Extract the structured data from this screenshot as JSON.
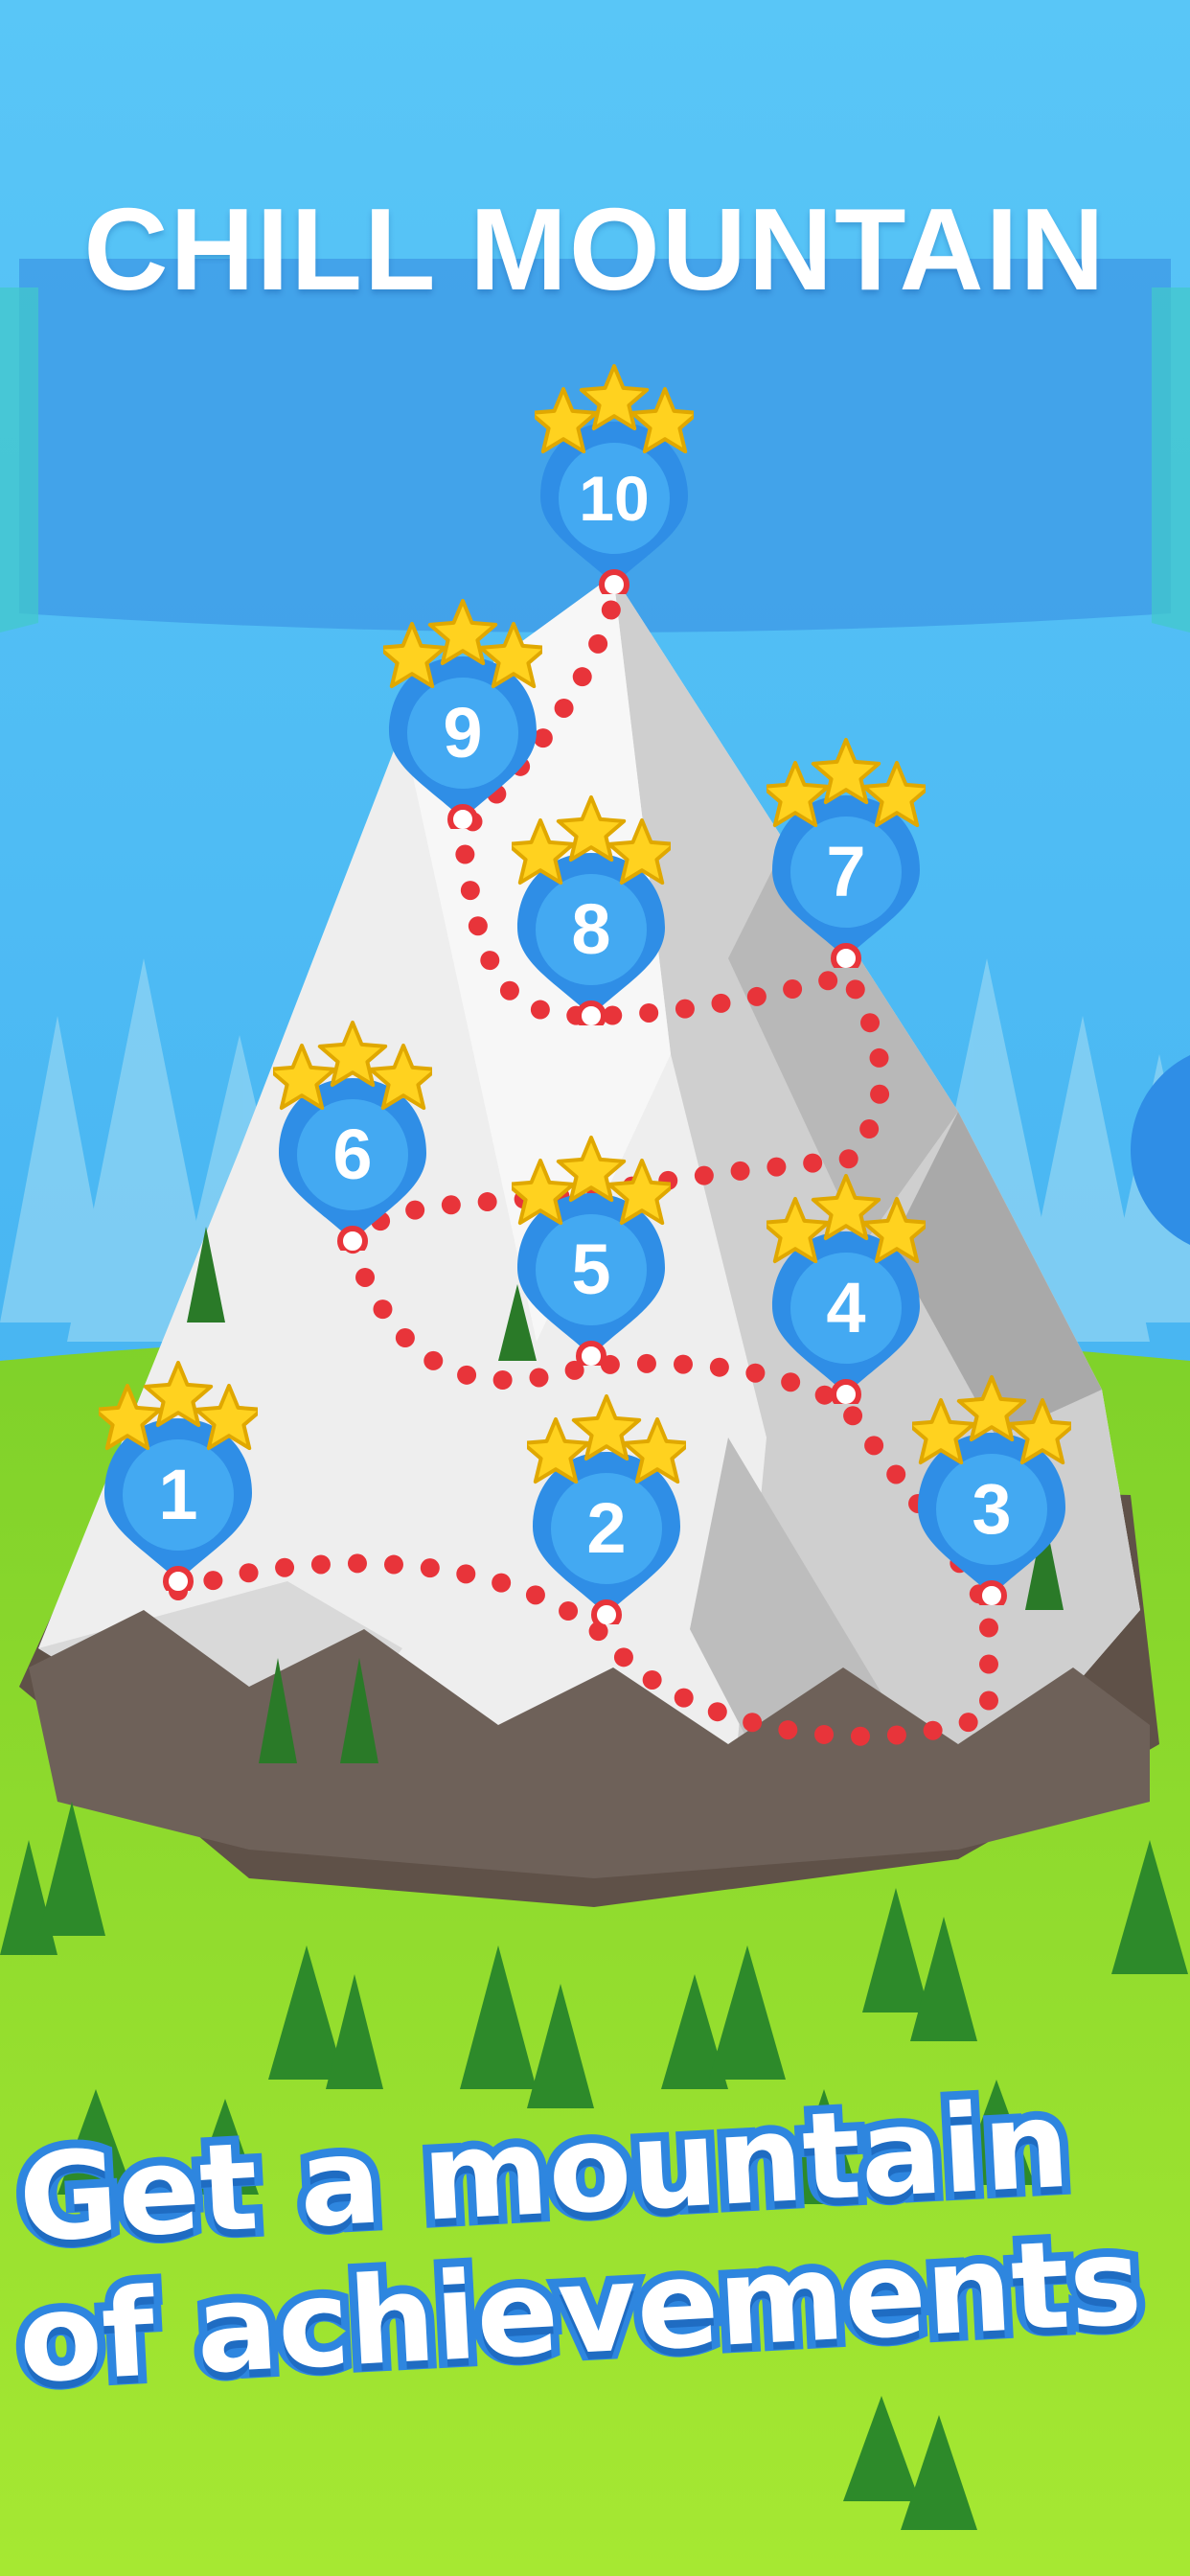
{
  "title": "CHILL MOUNTAIN",
  "levels": [
    {
      "number": "1",
      "stars": 3
    },
    {
      "number": "2",
      "stars": 3
    },
    {
      "number": "3",
      "stars": 3
    },
    {
      "number": "4",
      "stars": 3
    },
    {
      "number": "5",
      "stars": 3
    },
    {
      "number": "6",
      "stars": 3
    },
    {
      "number": "7",
      "stars": 3
    },
    {
      "number": "8",
      "stars": 3
    },
    {
      "number": "9",
      "stars": 3
    },
    {
      "number": "10",
      "stars": 3
    }
  ],
  "tagline": {
    "line1": "Get a mountain",
    "line2": "of achievements"
  },
  "colors": {
    "sky": "#48b9f2",
    "pin": "#2f8ee6",
    "star": "#ffd21f",
    "path": "#e8343a",
    "grass": "#8fd62a",
    "tagline_outline": "#2e86df"
  }
}
